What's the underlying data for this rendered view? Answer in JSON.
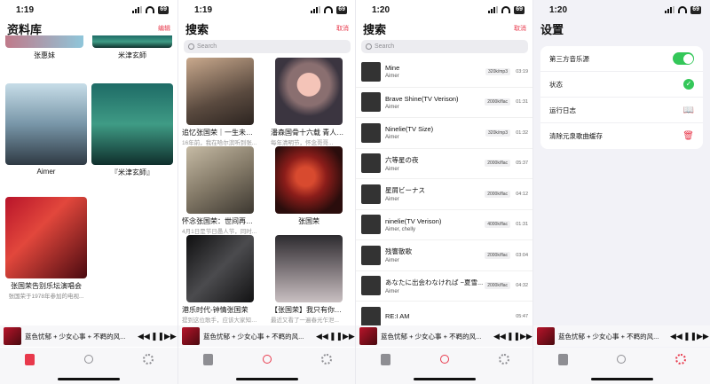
{
  "screens": [
    {
      "status_time": "1:19",
      "battery": "69",
      "title": "资料库",
      "action": "编辑",
      "cards": [
        {
          "caption": "张惠妹",
          "sub": ""
        },
        {
          "caption": "米津玄師",
          "sub": ""
        },
        {
          "caption": "Aimer",
          "sub": ""
        },
        {
          "caption": "『米津玄師』",
          "sub": ""
        },
        {
          "caption": "张国荣告别乐坛演唱会",
          "sub": "张国荣于1978年参加的电视..."
        }
      ]
    },
    {
      "status_time": "1:19",
      "battery": "69",
      "title": "搜索",
      "action": "取消",
      "search_placeholder": "Search",
      "results": [
        {
          "caption": "追忆张国荣｜一生未见，...",
          "sub": "16年前，我在哈尔滨听到张..."
        },
        {
          "caption": "潘森国骨十六载 青人节...",
          "sub": "每年清明节，怀念哥哥..."
        },
        {
          "caption": "怀念张国荣：世间再无风...",
          "sub": "4月1日是节日愚人节，同时..."
        },
        {
          "caption": "张国荣",
          "sub": ""
        },
        {
          "caption": "港乐时代-钟情张国荣",
          "sub": "提到这位歌手，应该大家知道..."
        },
        {
          "caption": "【张国荣】我只有你，而...",
          "sub": "最近又看了一遍春光乍泄..."
        }
      ]
    },
    {
      "status_time": "1:20",
      "battery": "69",
      "title": "搜索",
      "action": "取消",
      "search_placeholder": "Search",
      "songs": [
        {
          "name": "Mine",
          "artist": "Aimer",
          "fmt": "320k/mp3",
          "dur": "03:19"
        },
        {
          "name": "Brave Shine(TV Verison)",
          "artist": "Aimer",
          "fmt": "2000k/flac",
          "dur": "01:31"
        },
        {
          "name": "Ninelie(TV Size)",
          "artist": "Aimer",
          "fmt": "320k/mp3",
          "dur": "01:32"
        },
        {
          "name": "六等星の夜",
          "artist": "Aimer",
          "fmt": "2000k/flac",
          "dur": "05:37"
        },
        {
          "name": "星屑ビーナス",
          "artist": "Aimer",
          "fmt": "2000k/flac",
          "dur": "04:12"
        },
        {
          "name": "ninelie(TV Verison)",
          "artist": "Aimer, chelly",
          "fmt": "4000k/flac",
          "dur": "01:31"
        },
        {
          "name": "残響散歌",
          "artist": "Aimer",
          "fmt": "2000k/flac",
          "dur": "03:04"
        },
        {
          "name": "あなたに出会わなければ ~夏雪...",
          "artist": "Aimer",
          "fmt": "2000k/flac",
          "dur": "04:32"
        },
        {
          "name": "RE:I AM",
          "artist": "",
          "fmt": "",
          "dur": "05:47"
        }
      ]
    },
    {
      "status_time": "1:20",
      "battery": "69",
      "title": "设置",
      "rows": [
        {
          "label": "第三方音乐源"
        },
        {
          "label": "状态"
        },
        {
          "label": "运行日志"
        },
        {
          "label": "清除元泉歌曲缓存"
        }
      ]
    }
  ],
  "mini_player": {
    "title": "蓝色忧郁 + 少女心事 + 不羁的风...",
    "controls": {
      "prev": "◀◀",
      "pause": "❚❚",
      "next": "▶▶"
    }
  },
  "tabs": [
    "library-icon",
    "search-icon",
    "settings-icon"
  ],
  "colors": {
    "accent": "#e8394c",
    "green": "#34c759"
  }
}
